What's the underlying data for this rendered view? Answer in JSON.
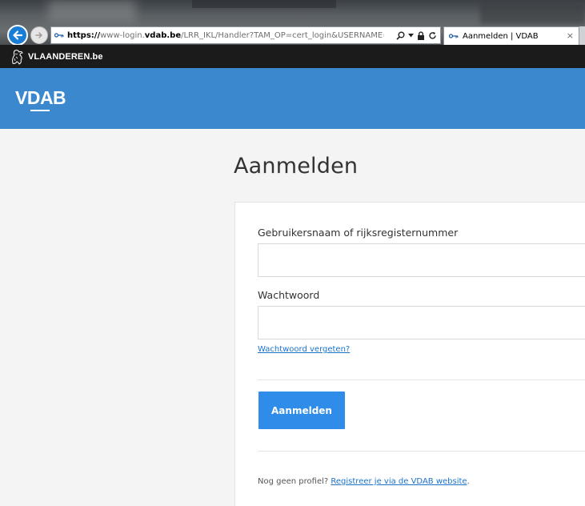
{
  "browser": {
    "address": {
      "proto": "https://",
      "domain_prefix": "www-login.",
      "domain": "vdab.be",
      "path": "/LRR_IKL/Handler?TAM_OP=cert_login&USERNAME=unauth"
    },
    "tab": {
      "title": "Aanmelden | VDAB",
      "close": "×"
    },
    "icons": [
      "back-icon",
      "forward-icon",
      "key-icon",
      "search-icon",
      "lock-icon",
      "refresh-icon",
      "close-icon"
    ]
  },
  "vlaanderen": {
    "label": "VLAANDEREN.be"
  },
  "header": {
    "logo": "VDAB",
    "background": "#3b88cf"
  },
  "main": {
    "title": "Aanmelden",
    "form": {
      "username_label": "Gebruikersnaam of rijksregisternummer",
      "username_value": "",
      "password_label": "Wachtwoord",
      "password_value": "",
      "forgot_link": "Wachtwoord vergeten?",
      "submit_label": "Aanmelden",
      "no_profile_text": "Nog geen profiel?",
      "register_link": "Registreer je via de VDAB website",
      "register_suffix": "."
    }
  },
  "colors": {
    "accent": "#2f8ce8",
    "link": "#1a73c9",
    "topbar": "#1b1b1b"
  }
}
